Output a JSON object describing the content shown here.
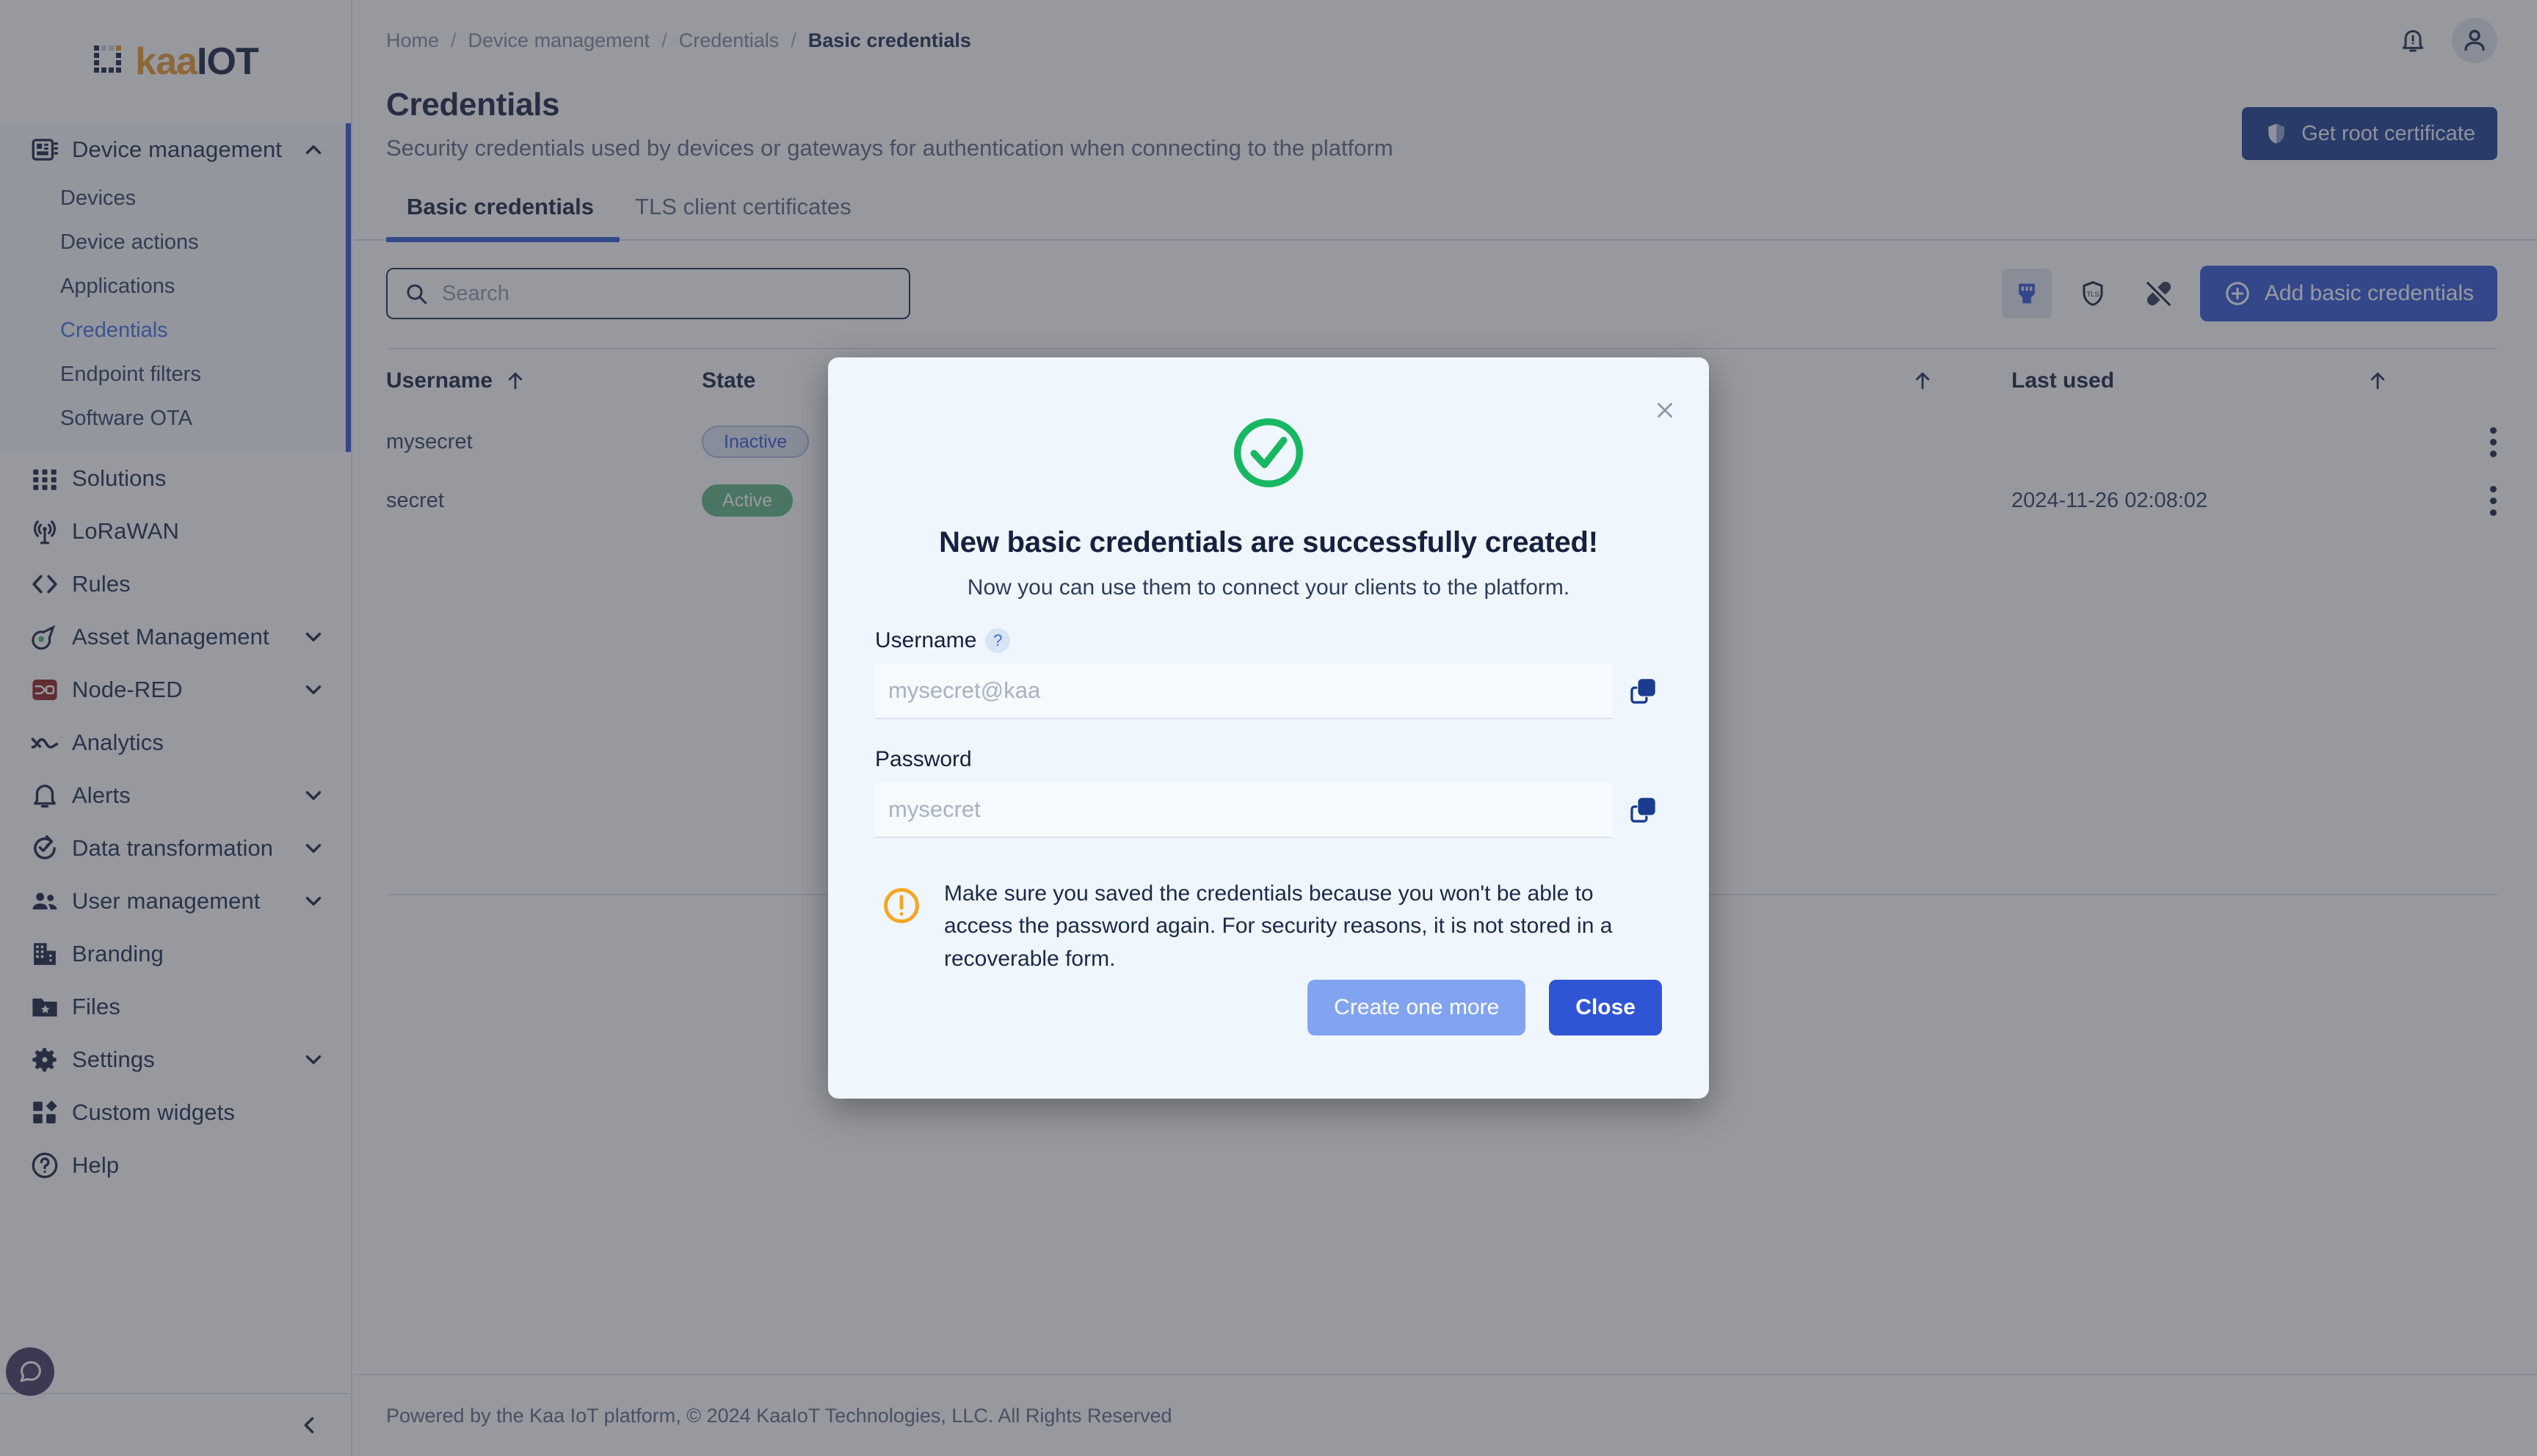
{
  "brand": {
    "logo_kaa": "kaa",
    "logo_iot": "IOT",
    "accent_blue": "#2f55d4",
    "accent_orange": "#e8972b",
    "success_green": "#18b863",
    "warning_orange": "#f5a623"
  },
  "sidebar": {
    "groups": [
      {
        "label": "Device management",
        "icon": "chip-icon",
        "expanded": true,
        "chevron": "chevron-up-icon",
        "items": [
          {
            "label": "Devices",
            "active": false
          },
          {
            "label": "Device actions",
            "active": false
          },
          {
            "label": "Applications",
            "active": false
          },
          {
            "label": "Credentials",
            "active": true
          },
          {
            "label": "Endpoint filters",
            "active": false
          },
          {
            "label": "Software OTA",
            "active": false
          }
        ]
      },
      {
        "label": "Solutions",
        "icon": "grid-icon",
        "expanded": false,
        "chevron": null,
        "items": []
      },
      {
        "label": "LoRaWAN",
        "icon": "antenna-icon",
        "expanded": false,
        "chevron": null,
        "items": []
      },
      {
        "label": "Rules",
        "icon": "code-brackets-icon",
        "expanded": false,
        "chevron": null,
        "items": []
      },
      {
        "label": "Asset Management",
        "icon": "asset-tag-icon",
        "expanded": false,
        "chevron": "chevron-down-icon",
        "items": []
      },
      {
        "label": "Node-RED",
        "icon": "node-red-icon",
        "expanded": false,
        "chevron": "chevron-down-icon",
        "items": []
      },
      {
        "label": "Analytics",
        "icon": "analytics-line-icon",
        "expanded": false,
        "chevron": null,
        "items": []
      },
      {
        "label": "Alerts",
        "icon": "bell-icon",
        "expanded": false,
        "chevron": "chevron-down-icon",
        "items": []
      },
      {
        "label": "Data transformation",
        "icon": "refresh-check-icon",
        "expanded": false,
        "chevron": "chevron-down-icon",
        "items": []
      },
      {
        "label": "User management",
        "icon": "users-icon",
        "expanded": false,
        "chevron": "chevron-down-icon",
        "items": []
      },
      {
        "label": "Branding",
        "icon": "building-icon",
        "expanded": false,
        "chevron": null,
        "items": []
      },
      {
        "label": "Files",
        "icon": "folder-star-icon",
        "expanded": false,
        "chevron": null,
        "items": []
      },
      {
        "label": "Settings",
        "icon": "gear-icon",
        "expanded": false,
        "chevron": "chevron-down-icon",
        "items": []
      },
      {
        "label": "Custom widgets",
        "icon": "widgets-icon",
        "expanded": false,
        "chevron": null,
        "items": []
      },
      {
        "label": "Help",
        "icon": "help-circle-icon",
        "expanded": false,
        "chevron": null,
        "items": []
      }
    ],
    "collapse_icon": "chevron-left-icon",
    "chat_icon": "chat-bubble-icon"
  },
  "topbar": {
    "breadcrumb": [
      {
        "label": "Home",
        "current": false
      },
      {
        "label": "Device management",
        "current": false
      },
      {
        "label": "Credentials",
        "current": false
      },
      {
        "label": "Basic credentials",
        "current": true
      }
    ],
    "separator": "/",
    "notifications_icon": "bell-alert-icon",
    "avatar_icon": "user-icon"
  },
  "page": {
    "title": "Credentials",
    "subtitle": "Security credentials used by devices or gateways for authentication when connecting to the platform",
    "get_root_certificate_label": "Get root certificate",
    "get_root_certificate_icon": "shield-icon"
  },
  "tabs": [
    {
      "label": "Basic credentials",
      "active": true
    },
    {
      "label": "TLS client certificates",
      "active": false
    }
  ],
  "toolbar": {
    "search_placeholder": "Search",
    "search_value": "",
    "search_icon": "search-icon",
    "filters": [
      {
        "icon": "connector-plug-icon",
        "selected": true
      },
      {
        "icon": "tls-shield-icon",
        "selected": false
      },
      {
        "icon": "disconnected-icon",
        "selected": false
      }
    ],
    "add_button_label": "Add basic credentials",
    "add_button_icon": "plus-circle-icon"
  },
  "table": {
    "columns": [
      {
        "label": "Username",
        "sort_icon": "sort-asc-icon"
      },
      {
        "label": "State",
        "sort_icon": null
      },
      {
        "label": "",
        "sort_icon": "sort-asc-icon"
      },
      {
        "label": "Last used",
        "sort_icon": "sort-asc-icon"
      }
    ],
    "rows": [
      {
        "username": "mysecret",
        "state": "Inactive",
        "state_kind": "inactive",
        "last_used": "",
        "menu_icon": "kebab-menu-icon"
      },
      {
        "username": "secret",
        "state": "Active",
        "state_kind": "active",
        "last_used": "2024-11-26 02:08:02",
        "menu_icon": "kebab-menu-icon"
      }
    ]
  },
  "footer": {
    "text": "Powered by the Kaa IoT platform, © 2024 KaaIoT Technologies, LLC. All Rights Reserved"
  },
  "modal": {
    "close_icon": "close-icon",
    "status_icon": "success-check-circle-icon",
    "title": "New basic credentials are successfully created!",
    "subtitle": "Now you can use them to connect your clients to the platform.",
    "fields": [
      {
        "label": "Username",
        "has_help": true,
        "help_icon": "question-mark-icon",
        "value": "",
        "placeholder": "mysecret@kaa",
        "copy_icon": "copy-icon"
      },
      {
        "label": "Password",
        "has_help": false,
        "help_icon": null,
        "value": "",
        "placeholder": "mysecret",
        "copy_icon": "copy-icon"
      }
    ],
    "warning_icon": "warning-exclamation-icon",
    "warning_text": "Make sure you saved the credentials because you won't be able to access the password again. For security reasons, it is not stored in a recoverable form.",
    "buttons": [
      {
        "label": "Create one more",
        "kind": "secondary"
      },
      {
        "label": "Close",
        "kind": "primary"
      }
    ]
  }
}
